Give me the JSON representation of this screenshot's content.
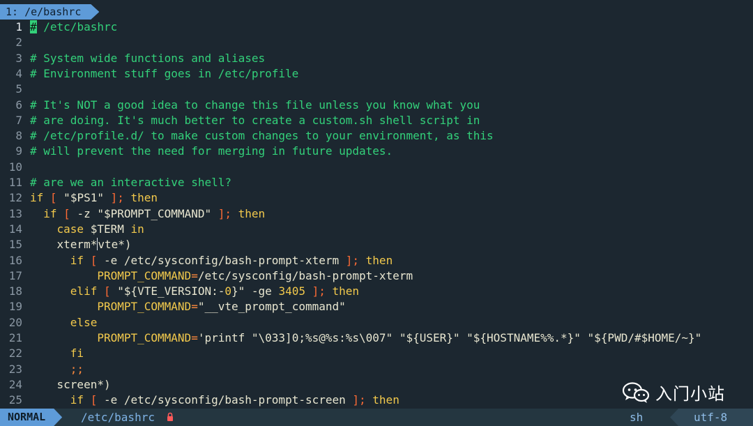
{
  "tabline": {
    "tab_label": "1: /e/bashrc"
  },
  "editor": {
    "lines": [
      {
        "num": "1",
        "segments": [
          {
            "t": "#",
            "c": "cursor"
          },
          {
            "t": " /etc/bashrc",
            "c": "cm"
          }
        ]
      },
      {
        "num": "2",
        "segments": []
      },
      {
        "num": "3",
        "segments": [
          {
            "t": "# System wide functions and aliases",
            "c": "cm"
          }
        ]
      },
      {
        "num": "4",
        "segments": [
          {
            "t": "# Environment stuff goes in /etc/profile",
            "c": "cm"
          }
        ]
      },
      {
        "num": "5",
        "segments": []
      },
      {
        "num": "6",
        "segments": [
          {
            "t": "# It's NOT a good idea to change this file unless you know what you",
            "c": "cm"
          }
        ]
      },
      {
        "num": "7",
        "segments": [
          {
            "t": "# are doing. It's much better to create a custom.sh shell script in",
            "c": "cm"
          }
        ]
      },
      {
        "num": "8",
        "segments": [
          {
            "t": "# /etc/profile.d/ to make custom changes to your environment, as this",
            "c": "cm"
          }
        ]
      },
      {
        "num": "9",
        "segments": [
          {
            "t": "# will prevent the need for merging in future updates.",
            "c": "cm"
          }
        ]
      },
      {
        "num": "10",
        "segments": []
      },
      {
        "num": "11",
        "segments": [
          {
            "t": "# are we an interactive shell?",
            "c": "cm"
          }
        ]
      },
      {
        "num": "12",
        "segments": [
          {
            "t": "if",
            "c": "kw"
          },
          {
            "t": " ",
            "c": ""
          },
          {
            "t": "[",
            "c": "br"
          },
          {
            "t": " \"$PS1\" ",
            "c": "st"
          },
          {
            "t": "];",
            "c": "br"
          },
          {
            "t": " then",
            "c": "kw"
          }
        ]
      },
      {
        "num": "13",
        "segments": [
          {
            "t": "  ",
            "c": ""
          },
          {
            "t": "if",
            "c": "kw"
          },
          {
            "t": " ",
            "c": ""
          },
          {
            "t": "[",
            "c": "br"
          },
          {
            "t": " -z \"$PROMPT_COMMAND\" ",
            "c": "st"
          },
          {
            "t": "];",
            "c": "br"
          },
          {
            "t": " then",
            "c": "kw"
          }
        ]
      },
      {
        "num": "14",
        "segments": [
          {
            "t": "    ",
            "c": ""
          },
          {
            "t": "case",
            "c": "kw"
          },
          {
            "t": " $TERM ",
            "c": "st"
          },
          {
            "t": "in",
            "c": "kw"
          }
        ]
      },
      {
        "num": "15",
        "segments": [
          {
            "t": "    xterm*",
            "c": "st"
          },
          {
            "t": "|",
            "c": "bar"
          },
          {
            "t": "vte*)",
            "c": "st"
          }
        ]
      },
      {
        "num": "16",
        "segments": [
          {
            "t": "      ",
            "c": ""
          },
          {
            "t": "if",
            "c": "kw"
          },
          {
            "t": " ",
            "c": ""
          },
          {
            "t": "[",
            "c": "br"
          },
          {
            "t": " -e /etc/sysconfig/bash-prompt-xterm ",
            "c": "st"
          },
          {
            "t": "];",
            "c": "br"
          },
          {
            "t": " then",
            "c": "kw"
          }
        ]
      },
      {
        "num": "17",
        "segments": [
          {
            "t": "          PROMPT_COMMAND",
            "c": "kw"
          },
          {
            "t": "=",
            "c": "op"
          },
          {
            "t": "/etc/sysconfig/bash-prompt-xterm",
            "c": "st"
          }
        ]
      },
      {
        "num": "18",
        "segments": [
          {
            "t": "      ",
            "c": ""
          },
          {
            "t": "elif",
            "c": "kw"
          },
          {
            "t": " ",
            "c": ""
          },
          {
            "t": "[",
            "c": "br"
          },
          {
            "t": " \"${VTE_VERSION:-",
            "c": "st"
          },
          {
            "t": "0",
            "c": "nm"
          },
          {
            "t": "}\" -ge ",
            "c": "st"
          },
          {
            "t": "3405",
            "c": "nm"
          },
          {
            "t": " ",
            "c": ""
          },
          {
            "t": "];",
            "c": "br"
          },
          {
            "t": " then",
            "c": "kw"
          }
        ]
      },
      {
        "num": "19",
        "segments": [
          {
            "t": "          PROMPT_COMMAND",
            "c": "kw"
          },
          {
            "t": "=",
            "c": "op"
          },
          {
            "t": "\"__vte_prompt_command\"",
            "c": "st"
          }
        ]
      },
      {
        "num": "20",
        "segments": [
          {
            "t": "      ",
            "c": ""
          },
          {
            "t": "else",
            "c": "kw"
          }
        ]
      },
      {
        "num": "21",
        "segments": [
          {
            "t": "          PROMPT_COMMAND",
            "c": "kw"
          },
          {
            "t": "=",
            "c": "op"
          },
          {
            "t": "'printf \"\\033]0;%s@%s:%s\\007\" \"${USER}\" \"${HOSTNAME%%.*}\" \"${PWD/#$HOME/~}\"",
            "c": "st"
          }
        ]
      },
      {
        "num": "22",
        "segments": [
          {
            "t": "      ",
            "c": ""
          },
          {
            "t": "fi",
            "c": "kw"
          }
        ]
      },
      {
        "num": "23",
        "segments": [
          {
            "t": "      ",
            "c": ""
          },
          {
            "t": ";;",
            "c": "op"
          }
        ]
      },
      {
        "num": "24",
        "segments": [
          {
            "t": "    screen*)",
            "c": "st"
          }
        ]
      },
      {
        "num": "25",
        "segments": [
          {
            "t": "      ",
            "c": ""
          },
          {
            "t": "if",
            "c": "kw"
          },
          {
            "t": " ",
            "c": ""
          },
          {
            "t": "[",
            "c": "br"
          },
          {
            "t": " -e /etc/sysconfig/bash-prompt-screen ",
            "c": "st"
          },
          {
            "t": "];",
            "c": "br"
          },
          {
            "t": " then",
            "c": "kw"
          }
        ]
      }
    ]
  },
  "statusline": {
    "mode": "NORMAL",
    "filename": "/etc/bashrc",
    "readonly_icon": "lock-icon",
    "filetype": "sh",
    "encoding": "utf-8"
  },
  "watermark": {
    "icon": "wechat-icon",
    "text": "入门小站"
  },
  "colors": {
    "background": "#1c2730",
    "comment": "#33d17a",
    "keyword": "#f2c94c",
    "bracket": "#ff6b35",
    "string": "#e8e6d0",
    "accent": "#5e9bd8"
  }
}
